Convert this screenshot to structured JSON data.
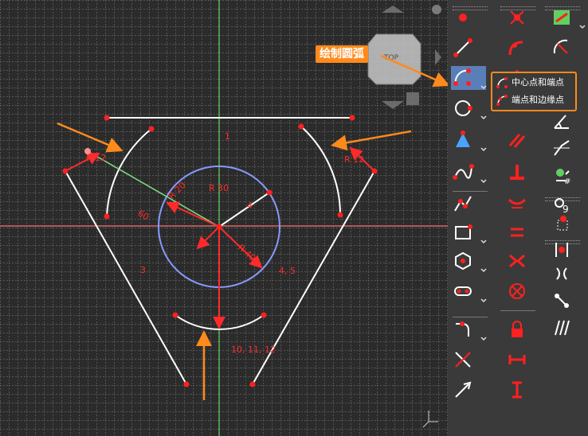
{
  "app": "FreeCAD Sketcher",
  "canvas": {
    "dimensions": [
      "R 12",
      "R 12",
      "R 20",
      "R 30",
      "R 40",
      "60"
    ],
    "constraint_tags": [
      "1",
      "3",
      "4",
      "4, 5",
      "10, 11, 12"
    ],
    "colors": {
      "background": "#2b2b2b",
      "geometry": "#ffffff",
      "construction_circle": "#8899ff",
      "constraint": "#ff2b2b",
      "point": "#ff2020",
      "axis_x": "#ff7070",
      "axis_y": "#60d060",
      "highlight_line": "#80e080",
      "annotation": "#ff8a1c"
    }
  },
  "callout": {
    "label": "绘制圆弧"
  },
  "arc_popup": {
    "items": [
      {
        "label": "中心点和端点",
        "icon": "arc-center-icon"
      },
      {
        "label": "端点和边缘点",
        "icon": "arc-3point-icon"
      }
    ]
  },
  "toolbar": {
    "column1": [
      "point-icon",
      "line-icon",
      "arc-icon",
      "circle-icon",
      "conic-icon",
      "bspline-icon",
      "polyline-icon",
      "rectangle-icon",
      "polygon-icon",
      "slot-icon",
      "fillet-icon",
      "trim-icon",
      "extend-icon",
      "split-icon"
    ],
    "column2": [
      "coincident-icon",
      "point-on-object-icon",
      "vertical-icon",
      "horizontal-icon",
      "parallel-icon",
      "perpendicular-icon",
      "tangent-icon",
      "equal-icon",
      "symmetric-icon",
      "block-icon",
      "lock-icon",
      "horizontal-distance-icon",
      "vertical-distance-icon",
      "distance-icon"
    ],
    "column3": [
      "toggle-construction-icon",
      "radius-icon",
      "diameter-icon",
      "angle-icon",
      "snell-icon",
      "internal-alignment-icon",
      "select-constraints-icon",
      "select-elements-icon",
      "select-redundant-icon",
      "select-conflicting-icon",
      "select-origin-icon",
      "select-h-axis-icon"
    ]
  }
}
